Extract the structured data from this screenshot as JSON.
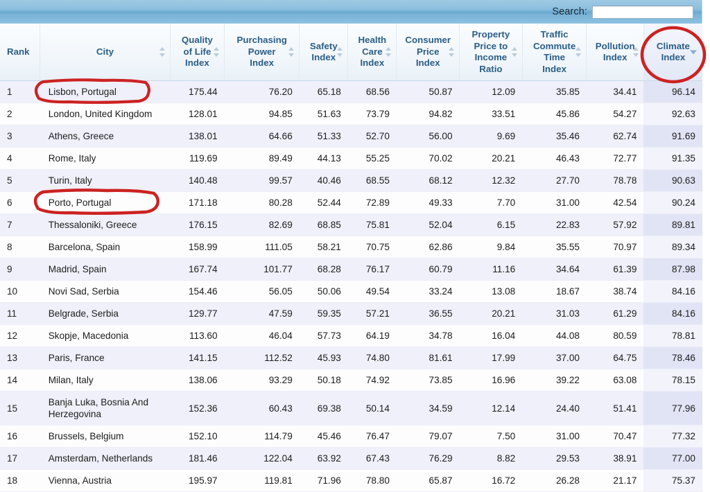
{
  "toolbar": {
    "search_label": "Search:",
    "search_value": "",
    "search_placeholder": ""
  },
  "accent_colors": {
    "toolbar_blue": "#8cc0df",
    "header_text_blue": "#2a5d86",
    "row_odd": "#f0f0fa",
    "row_even": "#fdfdfe",
    "sorted_col_odd": "#e1e4f4",
    "sorted_col_even": "#f2f3fb",
    "annotation_red": "#cc2222"
  },
  "table": {
    "columns": [
      {
        "key": "rank",
        "label": "Rank",
        "sortable": false,
        "sort": "none"
      },
      {
        "key": "city",
        "label": "City",
        "sortable": true,
        "sort": "none"
      },
      {
        "key": "quality",
        "label": "Quality of Life Index",
        "sortable": true,
        "sort": "none"
      },
      {
        "key": "power",
        "label": "Purchasing Power Index",
        "sortable": true,
        "sort": "none"
      },
      {
        "key": "safety",
        "label": "Safety Index",
        "sortable": true,
        "sort": "none"
      },
      {
        "key": "health",
        "label": "Health Care Index",
        "sortable": true,
        "sort": "none"
      },
      {
        "key": "cpi",
        "label": "Consumer Price Index",
        "sortable": true,
        "sort": "none"
      },
      {
        "key": "prop",
        "label": "Property Price to Income Ratio",
        "sortable": true,
        "sort": "none"
      },
      {
        "key": "traffic",
        "label": "Traffic Commute Time Index",
        "sortable": true,
        "sort": "none"
      },
      {
        "key": "poll",
        "label": "Pollution Index",
        "sortable": true,
        "sort": "none"
      },
      {
        "key": "climate",
        "label": "Climate Index",
        "sortable": true,
        "sort": "desc"
      }
    ],
    "column_label_lines": [
      [
        "Rank"
      ],
      [
        "City"
      ],
      [
        "Quality",
        "of Life",
        "Index"
      ],
      [
        "Purchasing",
        "Power",
        "Index"
      ],
      [
        "Safety",
        "Index"
      ],
      [
        "Health",
        "Care",
        "Index"
      ],
      [
        "Consumer",
        "Price",
        "Index"
      ],
      [
        "Property",
        "Price to",
        "Income",
        "Ratio"
      ],
      [
        "Traffic",
        "Commute",
        "Time",
        "Index"
      ],
      [
        "Pollution",
        "Index"
      ],
      [
        "Climate",
        "Index"
      ]
    ],
    "rows": [
      {
        "rank": "1",
        "city": "Lisbon, Portugal",
        "quality": "175.44",
        "power": "76.20",
        "safety": "65.18",
        "health": "68.56",
        "cpi": "50.87",
        "prop": "12.09",
        "traffic": "35.85",
        "poll": "34.41",
        "climate": "96.14"
      },
      {
        "rank": "2",
        "city": "London, United Kingdom",
        "quality": "128.01",
        "power": "94.85",
        "safety": "51.63",
        "health": "73.79",
        "cpi": "94.82",
        "prop": "33.51",
        "traffic": "45.86",
        "poll": "54.27",
        "climate": "92.63"
      },
      {
        "rank": "3",
        "city": "Athens, Greece",
        "quality": "138.01",
        "power": "64.66",
        "safety": "51.33",
        "health": "52.70",
        "cpi": "56.00",
        "prop": "9.69",
        "traffic": "35.46",
        "poll": "62.74",
        "climate": "91.69"
      },
      {
        "rank": "4",
        "city": "Rome, Italy",
        "quality": "119.69",
        "power": "89.49",
        "safety": "44.13",
        "health": "55.25",
        "cpi": "70.02",
        "prop": "20.21",
        "traffic": "46.43",
        "poll": "72.77",
        "climate": "91.35"
      },
      {
        "rank": "5",
        "city": "Turin, Italy",
        "quality": "140.48",
        "power": "99.57",
        "safety": "40.46",
        "health": "68.55",
        "cpi": "68.12",
        "prop": "12.32",
        "traffic": "27.70",
        "poll": "78.78",
        "climate": "90.63"
      },
      {
        "rank": "6",
        "city": "Porto, Portugal",
        "quality": "171.18",
        "power": "80.28",
        "safety": "52.44",
        "health": "72.89",
        "cpi": "49.33",
        "prop": "7.70",
        "traffic": "31.00",
        "poll": "42.54",
        "climate": "90.24"
      },
      {
        "rank": "7",
        "city": "Thessaloniki, Greece",
        "quality": "176.15",
        "power": "82.69",
        "safety": "68.85",
        "health": "75.81",
        "cpi": "52.04",
        "prop": "6.15",
        "traffic": "22.83",
        "poll": "57.92",
        "climate": "89.81"
      },
      {
        "rank": "8",
        "city": "Barcelona, Spain",
        "quality": "158.99",
        "power": "111.05",
        "safety": "58.21",
        "health": "70.75",
        "cpi": "62.86",
        "prop": "9.84",
        "traffic": "35.55",
        "poll": "70.97",
        "climate": "89.34"
      },
      {
        "rank": "9",
        "city": "Madrid, Spain",
        "quality": "167.74",
        "power": "101.77",
        "safety": "68.28",
        "health": "76.17",
        "cpi": "60.79",
        "prop": "11.16",
        "traffic": "34.64",
        "poll": "61.39",
        "climate": "87.98"
      },
      {
        "rank": "10",
        "city": "Novi Sad, Serbia",
        "quality": "154.46",
        "power": "56.05",
        "safety": "50.06",
        "health": "49.54",
        "cpi": "33.24",
        "prop": "13.08",
        "traffic": "18.67",
        "poll": "38.74",
        "climate": "84.16"
      },
      {
        "rank": "11",
        "city": "Belgrade, Serbia",
        "quality": "129.77",
        "power": "47.59",
        "safety": "59.35",
        "health": "57.21",
        "cpi": "36.55",
        "prop": "20.21",
        "traffic": "31.03",
        "poll": "61.29",
        "climate": "84.16"
      },
      {
        "rank": "12",
        "city": "Skopje, Macedonia",
        "quality": "113.60",
        "power": "46.04",
        "safety": "57.73",
        "health": "64.19",
        "cpi": "34.78",
        "prop": "16.04",
        "traffic": "44.08",
        "poll": "80.59",
        "climate": "78.81"
      },
      {
        "rank": "13",
        "city": "Paris, France",
        "quality": "141.15",
        "power": "112.52",
        "safety": "45.93",
        "health": "74.80",
        "cpi": "81.61",
        "prop": "17.99",
        "traffic": "37.00",
        "poll": "64.75",
        "climate": "78.46"
      },
      {
        "rank": "14",
        "city": "Milan, Italy",
        "quality": "138.06",
        "power": "93.29",
        "safety": "50.18",
        "health": "74.92",
        "cpi": "73.85",
        "prop": "16.96",
        "traffic": "39.22",
        "poll": "63.08",
        "climate": "78.15"
      },
      {
        "rank": "15",
        "city": "Banja Luka, Bosnia And Herzegovina",
        "quality": "152.36",
        "power": "60.43",
        "safety": "69.38",
        "health": "50.14",
        "cpi": "34.59",
        "prop": "12.14",
        "traffic": "24.40",
        "poll": "51.41",
        "climate": "77.96"
      },
      {
        "rank": "16",
        "city": "Brussels, Belgium",
        "quality": "152.10",
        "power": "114.79",
        "safety": "45.46",
        "health": "76.47",
        "cpi": "79.07",
        "prop": "7.50",
        "traffic": "31.00",
        "poll": "70.47",
        "climate": "77.32"
      },
      {
        "rank": "17",
        "city": "Amsterdam, Netherlands",
        "quality": "181.46",
        "power": "122.04",
        "safety": "63.92",
        "health": "67.43",
        "cpi": "76.29",
        "prop": "8.82",
        "traffic": "29.53",
        "poll": "38.91",
        "climate": "77.00"
      },
      {
        "rank": "18",
        "city": "Vienna, Austria",
        "quality": "195.97",
        "power": "119.81",
        "safety": "71.96",
        "health": "78.80",
        "cpi": "65.87",
        "prop": "16.72",
        "traffic": "26.28",
        "poll": "21.17",
        "climate": "75.37"
      }
    ]
  },
  "annotations": [
    {
      "name": "highlight-lisbon-row",
      "shape": "rounded-rect",
      "target": "Lisbon, Portugal"
    },
    {
      "name": "highlight-porto-row",
      "shape": "rounded-rect",
      "target": "Porto, Portugal"
    },
    {
      "name": "highlight-climate-header",
      "shape": "ellipse",
      "target": "Climate Index"
    }
  ]
}
